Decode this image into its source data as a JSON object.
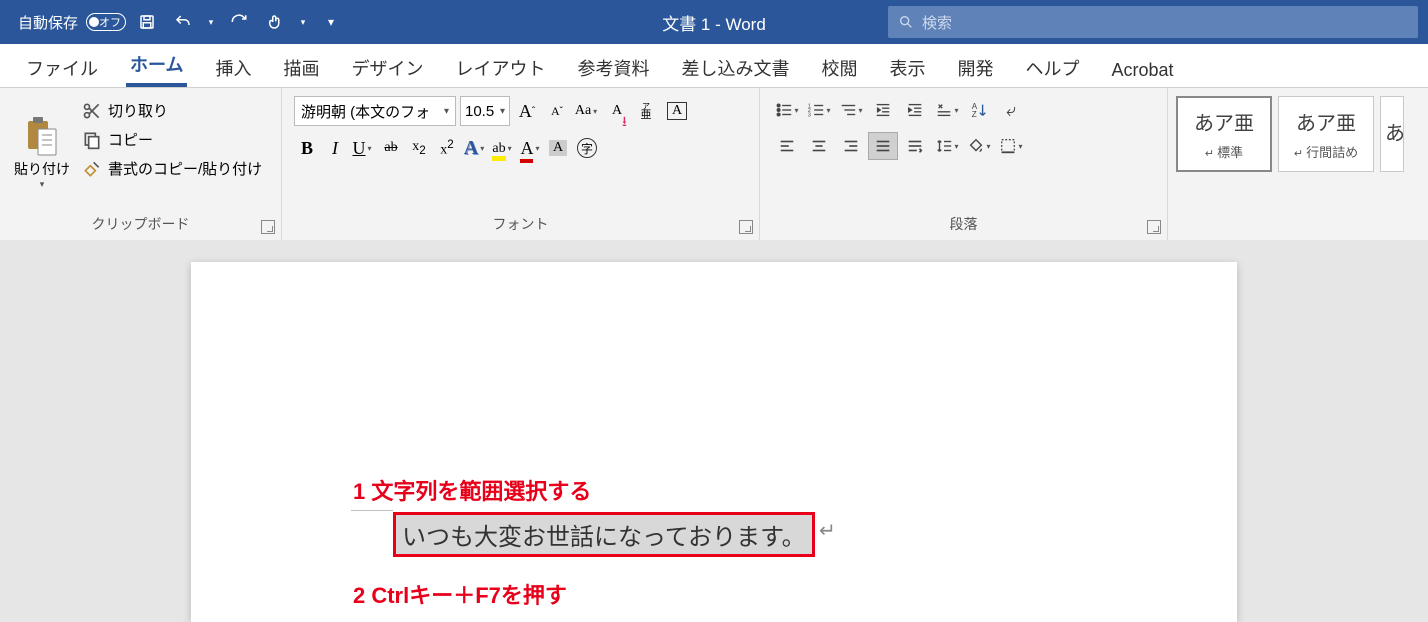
{
  "titlebar": {
    "autosave_label": "自動保存",
    "autosave_toggle": "オフ",
    "doc_title": "文書 1  -  Word",
    "search_placeholder": "検索"
  },
  "tabs": [
    "ファイル",
    "ホーム",
    "挿入",
    "描画",
    "デザイン",
    "レイアウト",
    "参考資料",
    "差し込み文書",
    "校閲",
    "表示",
    "開発",
    "ヘルプ",
    "Acrobat"
  ],
  "active_tab": 1,
  "clipboard": {
    "paste": "貼り付け",
    "cut": "切り取り",
    "copy": "コピー",
    "format_painter": "書式のコピー/貼り付け",
    "group_label": "クリップボード"
  },
  "font": {
    "name": "游明朝 (本文のフォ",
    "size": "10.5",
    "group_label": "フォント"
  },
  "paragraph": {
    "group_label": "段落"
  },
  "styles": {
    "sample": "あア亜",
    "normal": "標準",
    "no_spacing": "行間詰め"
  },
  "document": {
    "annotation1": "1 文字列を範囲選択する",
    "annotation2": "2 Ctrlキー＋F7を押す",
    "body": "いつも大変お世話になっております。"
  }
}
